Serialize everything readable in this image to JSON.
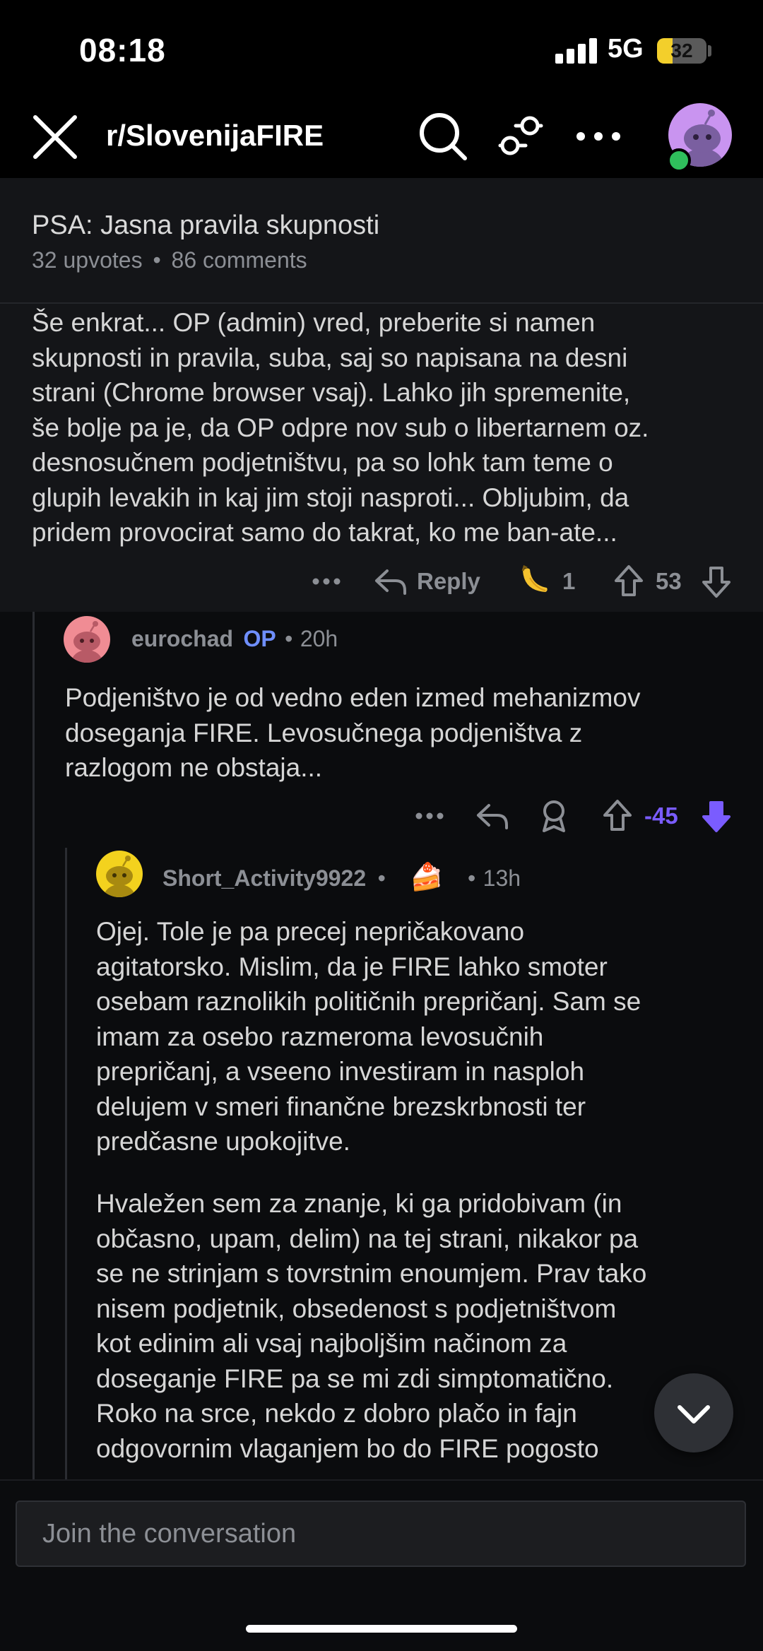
{
  "status_bar": {
    "time": "08:18",
    "network": "5G",
    "battery": "32",
    "battery_level": 0.32
  },
  "nav": {
    "subreddit": "r/SlovenijaFIRE",
    "colors": {
      "online": "#2fbf5c",
      "avatar_bg": "#c994f0"
    }
  },
  "post": {
    "title": "PSA: Jasna pravila skupnosti",
    "upvotes": "32 upvotes",
    "separator": "•",
    "comments": "86 comments"
  },
  "parent_comment": {
    "lines": [
      "Še enkrat... OP (admin) vred, preberite si namen",
      "skupnosti in pravila, suba, saj so napisana na desni",
      "strani (Chrome browser vsaj). Lahko jih spremenite,",
      "še bolje pa je, da OP odpre nov sub o libertarnem oz.",
      "desnosučnem podjetništvu, pa so lohk tam teme o",
      "glupih levakih in kaj jim stoji nasproti... Obljubim, da",
      "pridem provocirat samo do takrat, ko me ban-ate..."
    ],
    "reply_label": "Reply",
    "award_count": "1",
    "score": "53"
  },
  "reply_1": {
    "username": "eurochad",
    "op_badge": "OP",
    "separator": "•",
    "age": "20h",
    "lines": [
      "Podjeništvo je od vedno eden izmed mehanizmov",
      "doseganja FIRE. Levosučnega podjeništva z",
      "razlogom ne obstaja..."
    ],
    "score": "-45",
    "vote_color": "#7a5cff"
  },
  "reply_2": {
    "username": "Short_Activity9922",
    "separator": "•",
    "flair_emoji": "🍰",
    "age": "13h",
    "paragraph1": [
      "Ojej. Tole je pa precej nepričakovano",
      "agitatorsko. Mislim, da je FIRE lahko smoter",
      "osebam raznolikih političnih prepričanj. Sam se",
      "imam za osebo razmeroma levosučnih",
      "prepričanj, a vseeno investiram in nasploh",
      "delujem v smeri finančne brezskrbnosti ter",
      "predčasne upokojitve."
    ],
    "paragraph2": [
      "Hvaležen sem za znanje, ki ga pridobivam (in",
      "občasno, upam, delim) na tej strani, nikakor pa",
      "se ne strinjam s tovrstnim enoumjem. Prav tako",
      "nisem podjetnik, obsedenost s podjetništvom",
      "kot edinim ali vsaj najboljšim načinom za",
      "doseganje FIRE pa se mi zdi simptomatično.",
      "Roko na srce, nekdo z dobro plačo in fajn",
      "odgovornim vlaganjem bo do FIRE pogosto"
    ]
  },
  "composer": {
    "placeholder": "Join the conversation"
  }
}
